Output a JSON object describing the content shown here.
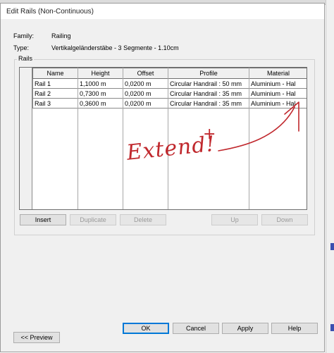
{
  "window": {
    "title": "Edit Rails (Non-Continuous)"
  },
  "info": {
    "family_label": "Family:",
    "family_value": "Railing",
    "type_label": "Type:",
    "type_value": "Vertikalgeländerstäbe - 3 Segmente - 1.10cm"
  },
  "rails_group": {
    "label": "Rails",
    "columns": [
      "Name",
      "Height",
      "Offset",
      "Profile",
      "Material"
    ],
    "rows": [
      {
        "num": "1",
        "name": "Rail 1",
        "height": "1,1000 m",
        "offset": "0,0200 m",
        "profile": "Circular Handrail : 50 mm",
        "material": "Aluminium - Hal"
      },
      {
        "num": "2",
        "name": "Rail 2",
        "height": "0,7300 m",
        "offset": "0,0200 m",
        "profile": "Circular Handrail : 35 mm",
        "material": "Aluminium - Hal"
      },
      {
        "num": "3",
        "name": "Rail 3",
        "height": "0,3600 m",
        "offset": "0,0200 m",
        "profile": "Circular Handrail : 35 mm",
        "material": "Aluminium - Hal"
      }
    ]
  },
  "buttons": {
    "insert": "Insert",
    "duplicate": "Duplicate",
    "delete": "Delete",
    "up": "Up",
    "down": "Down",
    "preview": "<< Preview",
    "ok": "OK",
    "cancel": "Cancel",
    "apply": "Apply",
    "help": "Help"
  },
  "annotation": {
    "text": "Extend!",
    "plus": "+",
    "color": "#c0282d"
  }
}
